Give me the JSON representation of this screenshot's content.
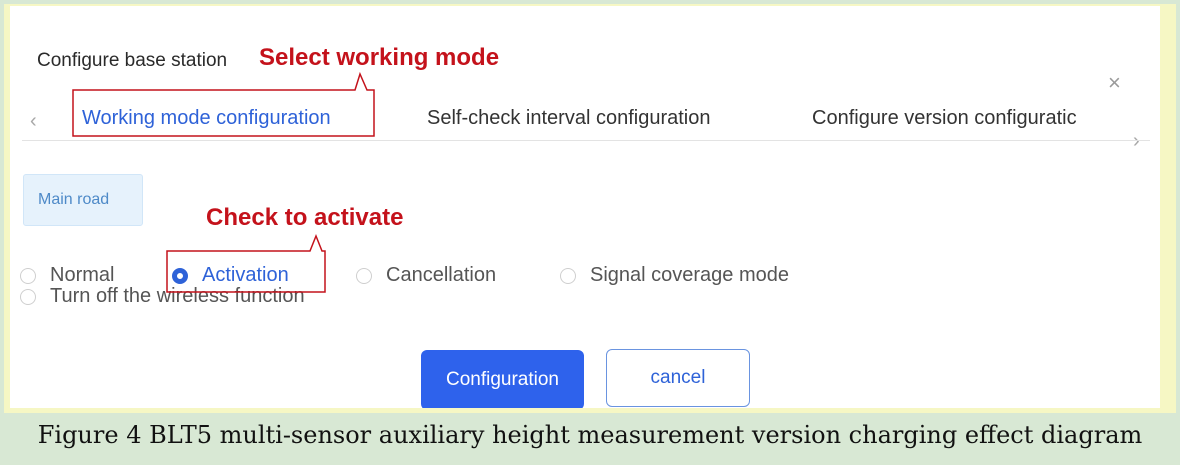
{
  "dialog": {
    "title": "Configure base station",
    "close_glyph": "×",
    "tabs": [
      {
        "label": "Working mode configuration",
        "active": true
      },
      {
        "label": "Self-check interval configuration",
        "active": false
      },
      {
        "label": "Configure version configuratic",
        "active": false
      }
    ],
    "tab_prev_glyph": "‹",
    "tab_next_glyph": "›",
    "chip_label": "Main road",
    "radio_options": [
      {
        "label": "Normal",
        "checked": false
      },
      {
        "label": "Activation",
        "checked": true
      },
      {
        "label": "Cancellation",
        "checked": false
      },
      {
        "label": "Signal coverage mode",
        "checked": false
      },
      {
        "label": "Turn off the wireless function",
        "checked": false
      }
    ],
    "confirm_button": "Configuration",
    "cancel_button": "cancel"
  },
  "annotations": {
    "select_mode": "Select working mode",
    "check_activate": "Check to activate"
  },
  "caption": "Figure 4 BLT5 multi-sensor auxiliary height measurement version charging effect diagram",
  "colors": {
    "accent": "#2e62d8",
    "annotation": "#c4121b",
    "chip_bg": "#e6f2fc"
  }
}
